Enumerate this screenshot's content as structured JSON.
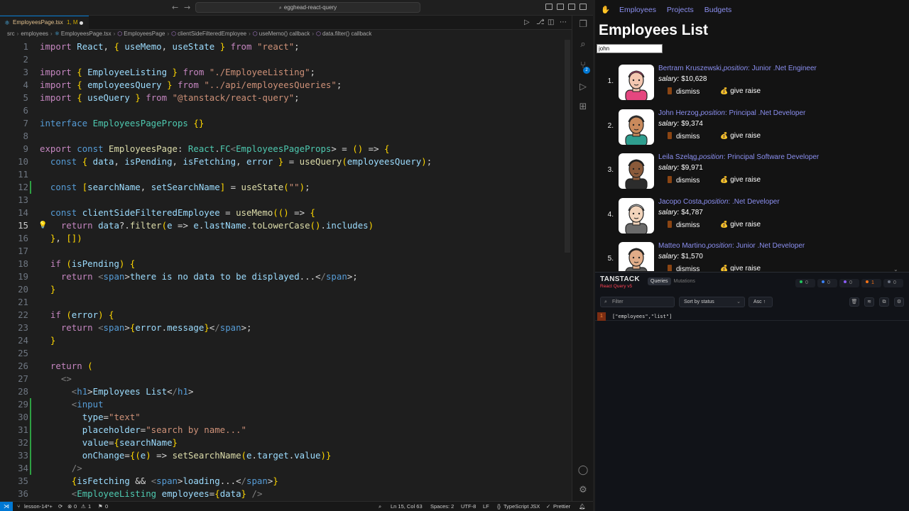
{
  "vscode": {
    "title": "egghead-react-query",
    "tab": {
      "label": "EmployeesPage.tsx",
      "status": "1, M"
    },
    "breadcrumb": [
      "src",
      "employees",
      "EmployeesPage.tsx",
      "EmployeesPage",
      "clientSideFilteredEmployee",
      "useMemo() callback",
      "data.filter() callback"
    ],
    "current_line": 15,
    "status": {
      "branch": "lesson-14*+",
      "errors": "0",
      "warnings": "1",
      "ports": "0",
      "position": "Ln 15, Col 63",
      "spaces": "Spaces: 2",
      "encoding": "UTF-8",
      "eol": "LF",
      "language": "TypeScript JSX",
      "formatter": "Prettier"
    },
    "activity_badge": "2",
    "code": [
      {
        "n": "1",
        "t": "import React, { useMemo, useState } from \"react\";"
      },
      {
        "n": "2",
        "t": ""
      },
      {
        "n": "3",
        "t": "import { EmployeeListing } from \"./EmployeeListing\";"
      },
      {
        "n": "4",
        "t": "import { employeesQuery } from \"../api/employeesQueries\";"
      },
      {
        "n": "5",
        "t": "import { useQuery } from \"@tanstack/react-query\";"
      },
      {
        "n": "6",
        "t": ""
      },
      {
        "n": "7",
        "t": "interface EmployeesPageProps {}"
      },
      {
        "n": "8",
        "t": ""
      },
      {
        "n": "9",
        "t": "export const EmployeesPage: React.FC<EmployeesPageProps> = () => {"
      },
      {
        "n": "10",
        "t": "  const { data, isPending, isFetching, error } = useQuery(employeesQuery);"
      },
      {
        "n": "11",
        "t": ""
      },
      {
        "n": "12",
        "t": "  const [searchName, setSearchName] = useState(\"\");"
      },
      {
        "n": "13",
        "t": ""
      },
      {
        "n": "14",
        "t": "  const clientSideFilteredEmployee = useMemo(() => {"
      },
      {
        "n": "15",
        "t": "    return data?.filter(e => e.lastName.toLowerCase().includes)"
      },
      {
        "n": "16",
        "t": "  }, [])"
      },
      {
        "n": "17",
        "t": ""
      },
      {
        "n": "18",
        "t": "  if (isPending) {"
      },
      {
        "n": "19",
        "t": "    return <span>there is no data to be displayed...</span>;"
      },
      {
        "n": "20",
        "t": "  }"
      },
      {
        "n": "21",
        "t": ""
      },
      {
        "n": "22",
        "t": "  if (error) {"
      },
      {
        "n": "23",
        "t": "    return <span>{error.message}</span>;"
      },
      {
        "n": "24",
        "t": "  }"
      },
      {
        "n": "25",
        "t": ""
      },
      {
        "n": "26",
        "t": "  return ("
      },
      {
        "n": "27",
        "t": "    <>"
      },
      {
        "n": "28",
        "t": "      <h1>Employees List</h1>"
      },
      {
        "n": "29",
        "t": "      <input"
      },
      {
        "n": "30",
        "t": "        type=\"text\""
      },
      {
        "n": "31",
        "t": "        placeholder=\"search by name...\""
      },
      {
        "n": "32",
        "t": "        value={searchName}"
      },
      {
        "n": "33",
        "t": "        onChange={(e) => setSearchName(e.target.value)}"
      },
      {
        "n": "34",
        "t": "      />"
      },
      {
        "n": "35",
        "t": "      {isFetching && <span>loading...</span>}"
      },
      {
        "n": "36",
        "t": "      <EmployeeListing employees={data} />"
      }
    ]
  },
  "app": {
    "nav": [
      "Employees",
      "Projects",
      "Budgets"
    ],
    "title": "Employees List",
    "search_value": "john",
    "position_label": "position",
    "salary_label": "salary:",
    "dismiss_label": "dismiss",
    "raise_label": "give raise",
    "employees": [
      {
        "num": "1.",
        "name": "Bertram Kruszewski,",
        "position": ": Junior .Net Engineer",
        "salary": "$10,628",
        "skin": "#f4c7b0",
        "hair": "#d24b7a",
        "shirt": "#e5467f"
      },
      {
        "num": "2.",
        "name": "John Herzog,",
        "position": ": Principal .Net Developer",
        "salary": "$9,374",
        "skin": "#c98a5c",
        "hair": "#3b3b3b",
        "shirt": "#2f9e8f"
      },
      {
        "num": "3.",
        "name": "Leila Szeląg,",
        "position": ": Principal Software Developer",
        "salary": "$9,971",
        "skin": "#8a5a3a",
        "hair": "#1f1f1f",
        "shirt": "#2c2c2c"
      },
      {
        "num": "4.",
        "name": "Jacopo Costa,",
        "position": ": .Net Developer",
        "salary": "$4,787",
        "skin": "#f2d4bb",
        "hair": "#d9d9d9",
        "shirt": "#6b6b6b"
      },
      {
        "num": "5.",
        "name": "Matteo Martino,",
        "position": ": Junior .Net Developer",
        "salary": "$1,570",
        "skin": "#e0ac88",
        "hair": "#2a2a2a",
        "shirt": "#555555"
      }
    ]
  },
  "devtools": {
    "brand": "TANSTACK",
    "sub": "React Query v5",
    "tabs": [
      "Queries",
      "Mutations"
    ],
    "stats": [
      {
        "value": "0",
        "color": "#22c55e"
      },
      {
        "value": "0",
        "color": "#3b82f6"
      },
      {
        "value": "0",
        "color": "#8b5cf6"
      },
      {
        "value": "1",
        "color": "#f97316"
      },
      {
        "value": "0",
        "color": "#6b7280"
      }
    ],
    "filter_placeholder": "Filter",
    "sort_label": "Sort by status",
    "asc_label": "Asc ↑",
    "query": {
      "count": "1",
      "key": "[\"employees\",\"list\"]"
    }
  }
}
